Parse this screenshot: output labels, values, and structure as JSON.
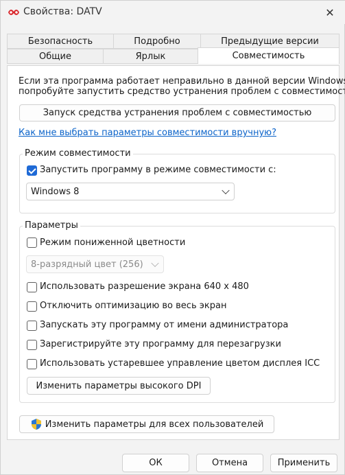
{
  "window": {
    "title": "Свойства: DATV"
  },
  "tabs": {
    "row1": [
      "Безопасность",
      "Подробно",
      "Предыдущие версии"
    ],
    "row2": [
      "Общие",
      "Ярлык",
      "Совместимость"
    ],
    "active": "Совместимость"
  },
  "compat": {
    "intro_line1": "Если эта программа работает неправильно в данной версии Windows",
    "intro_line2": "попробуйте запустить средство устранения проблем с совместимост",
    "troubleshooter_button": "Запуск средства устранения проблем с совместимостью",
    "manual_link": "Как мне выбрать параметры совместимости вручную?",
    "mode_group_label": "Режим совместимости",
    "mode_checkbox_label": "Запустить программу в режиме совместимости с:",
    "mode_checkbox_checked": true,
    "mode_select_value": "Windows 8",
    "params_group_label": "Параметры",
    "reduced_color_label": "Режим пониженной цветности",
    "reduced_color_checked": false,
    "color_select_value": "8-разрядный цвет (256)",
    "res640_label": "Использовать разрешение экрана 640 x 480",
    "res640_checked": false,
    "fullscreen_opt_label": "Отключить оптимизацию во весь экран",
    "fullscreen_opt_checked": false,
    "run_admin_label": "Запускать эту программу от имени администратора",
    "run_admin_checked": false,
    "register_restart_label": "Зарегистрируйте эту программу для перезагрузки",
    "register_restart_checked": false,
    "legacy_icc_label": "Использовать устаревшее управление цветом дисплея ICC",
    "legacy_icc_checked": false,
    "high_dpi_button": "Изменить параметры высокого DPI",
    "all_users_button": "Изменить параметры для всех пользователей"
  },
  "footer": {
    "ok": "ОК",
    "cancel": "Отмена",
    "apply": "Применить"
  },
  "colors": {
    "accent": "#1f6ad6",
    "link": "#0b63c9"
  }
}
